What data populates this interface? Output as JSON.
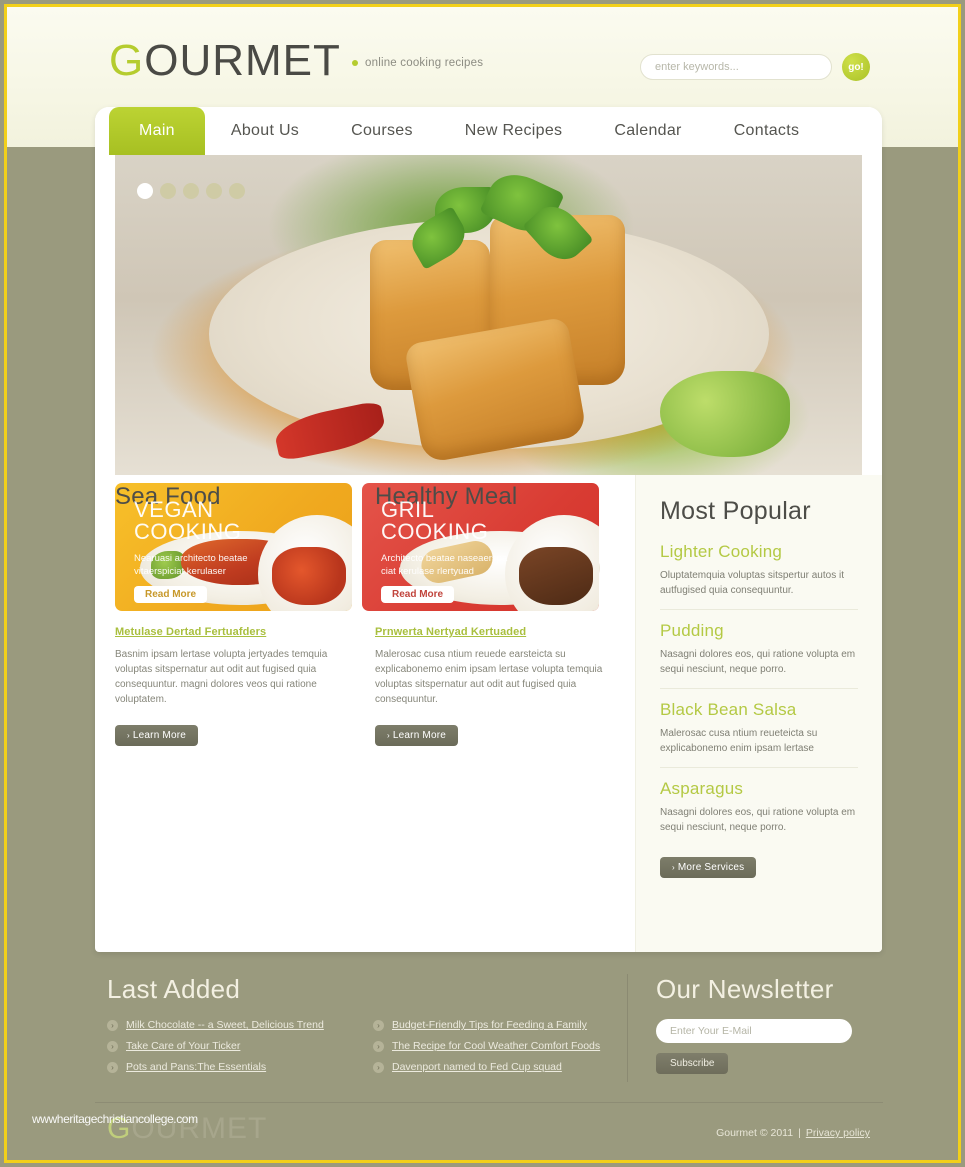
{
  "brand": {
    "logo_first": "G",
    "logo_rest": "OURMET",
    "tagline": "online cooking recipes",
    "footer_logo_first": "G",
    "footer_logo_rest": "OURMET"
  },
  "search": {
    "placeholder": "enter keywords...",
    "value": "",
    "button_label": "go!"
  },
  "nav": {
    "items": [
      {
        "label": "Main",
        "active": true
      },
      {
        "label": "About Us",
        "active": false
      },
      {
        "label": "Courses",
        "active": false
      },
      {
        "label": "New Recipes",
        "active": false
      },
      {
        "label": "Calendar",
        "active": false
      },
      {
        "label": "Contacts",
        "active": false
      }
    ]
  },
  "slider": {
    "dots": [
      {
        "active": true
      },
      {
        "active": false
      },
      {
        "active": false
      },
      {
        "active": false
      },
      {
        "active": false
      }
    ]
  },
  "promos": [
    {
      "title_line1": "VEGAN",
      "title_line2": "COOKING",
      "desc_line1": "Nearuasi architecto beatae",
      "desc_line2": "vitaerspiciat kerulaser",
      "button_label": "Read More",
      "color": "#f0a91f"
    },
    {
      "title_line1": "GRIL",
      "title_line2": "COOKING",
      "desc_line1": "Architecto beatae naseaerspa",
      "desc_line2": "ciat kerulase rlertyuad",
      "button_label": "Read More",
      "color": "#d93c33"
    }
  ],
  "columns": [
    {
      "title": "Sea Food",
      "link": "Metulase Dertad Fertuafders",
      "text": "Basnim ipsam lertase volupta jertyades temquia voluptas sitspernatur aut odit aut fugised quia consequuntur. magni dolores veos qui ratione voluptatem.",
      "button_label": "Learn More"
    },
    {
      "title": "Healthy Meal",
      "link": "Prnwerta Nertyad Kertuaded",
      "text": "Malerosac cusa ntium reuede earsteicta su explicabonemo enim ipsam lertase volupta temquia voluptas sitspernatur aut odit aut fugised quia consequuntur.",
      "button_label": "Learn More"
    }
  ],
  "sidebar": {
    "title": "Most Popular",
    "items": [
      {
        "title": "Lighter Cooking",
        "desc": "Oluptatemquia voluptas sitspertur autos it autfugised quia consequuntur."
      },
      {
        "title": "Pudding",
        "desc": "Nasagni dolores eos, qui ratione volupta em sequi nesciunt, neque porro."
      },
      {
        "title": "Black Bean Salsa",
        "desc": "Malerosac cusa ntium reueteicta su explicabonemo enim ipsam lertase"
      },
      {
        "title": "Asparagus",
        "desc": "Nasagni dolores eos, qui ratione volupta em sequi nesciunt, neque porro."
      }
    ],
    "button_label": "More Services"
  },
  "footer": {
    "last_added_title": "Last Added",
    "links_col1": [
      "Milk Chocolate -- a Sweet, Delicious Trend",
      "Take Care of Your Ticker",
      "Pots and Pans:The Essentials"
    ],
    "links_col2": [
      "Budget-Friendly Tips for Feeding a Family",
      "The Recipe for Cool Weather Comfort Foods",
      "Davenport named to Fed Cup squad"
    ],
    "newsletter_title": "Our Newsletter",
    "newsletter_placeholder": "Enter Your E-Mail",
    "newsletter_value": "",
    "subscribe_label": "Subscribe",
    "copyright": "Gourmet © 2011",
    "separator": "|",
    "privacy_label": "Privacy policy",
    "bullet_glyph": "›"
  },
  "watermark": {
    "text": "wwwheritagechristiancollege.com"
  },
  "colors": {
    "accent_green": "#b5cc2e",
    "background_olive": "#9a9a7e",
    "frame_gold": "#f2d01a",
    "promo_yellow": "#f0a91f",
    "promo_red": "#d93c33"
  }
}
